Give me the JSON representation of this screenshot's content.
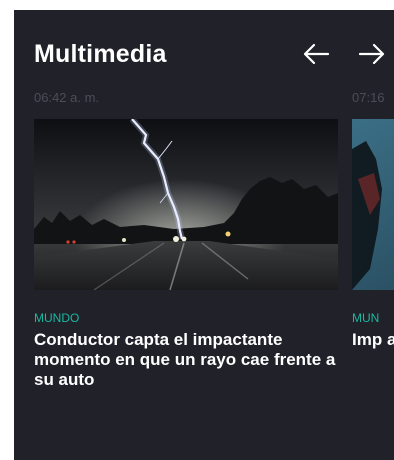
{
  "widget": {
    "title": "Multimedia",
    "nav": {
      "prev_icon": "arrow-left-icon",
      "next_icon": "arrow-right-icon"
    }
  },
  "cards": [
    {
      "time": "06:42 a. m.",
      "section": "MUNDO",
      "headline": "Conductor capta el impactante momento en que un rayo cae frente a su auto",
      "thumbnail": "lightning-road-night"
    },
    {
      "time": "07:16",
      "section": "MUN",
      "headline": "Imp a ur sus",
      "thumbnail": "partial-photo"
    }
  ],
  "colors": {
    "background": "#212129",
    "section": "#19b8a0",
    "time": "#4d4d57",
    "title": "#ffffff"
  }
}
